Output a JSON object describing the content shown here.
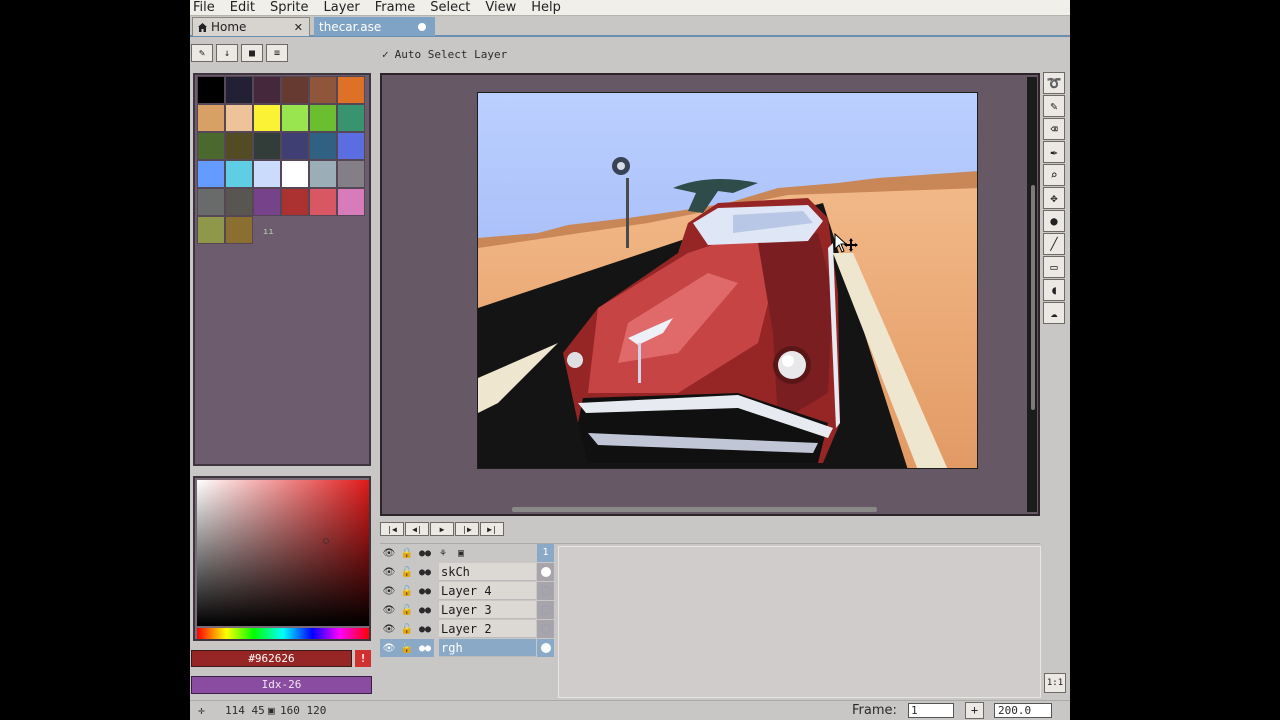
{
  "menu": [
    "File",
    "Edit",
    "Sprite",
    "Layer",
    "Frame",
    "Select",
    "View",
    "Help"
  ],
  "tabs": {
    "home": "Home",
    "file": "thecar.ase"
  },
  "context": {
    "auto_select": "Auto Select Layer"
  },
  "palette": {
    "colors": [
      "#000000",
      "#222034",
      "#45283c",
      "#663931",
      "#8f563b",
      "#df7126",
      "#d9a066",
      "#eec39a",
      "#fbf236",
      "#99e550",
      "#6abe30",
      "#37946e",
      "#4b692f",
      "#524b24",
      "#323c39",
      "#3f3f74",
      "#306082",
      "#5b6ee1",
      "#639bff",
      "#5fcde4",
      "#cbdbfc",
      "#ffffff",
      "#9badb7",
      "#847e87",
      "#696a6a",
      "#595652",
      "#76428a",
      "#ac3232",
      "#d95763",
      "#d77bba",
      "#8f974a",
      "#8a6f30"
    ],
    "marker": "ıı"
  },
  "color": {
    "hex": "#962626",
    "warn": "!",
    "index": "Idx-26"
  },
  "layers": [
    {
      "name": "skCh",
      "cel": "filled"
    },
    {
      "name": "Layer 4",
      "cel": "empty"
    },
    {
      "name": "Layer 3",
      "cel": "empty"
    },
    {
      "name": "Layer 2",
      "cel": "empty"
    },
    {
      "name": "rgh",
      "cel": "filled"
    }
  ],
  "timeline": {
    "frame_header": "1"
  },
  "status": {
    "coords": "114 45",
    "size": "160 120",
    "frame_label": "Frame:",
    "frame_value": "1",
    "add": "+",
    "zoom": "200.0"
  },
  "ratio_button": "1:1"
}
